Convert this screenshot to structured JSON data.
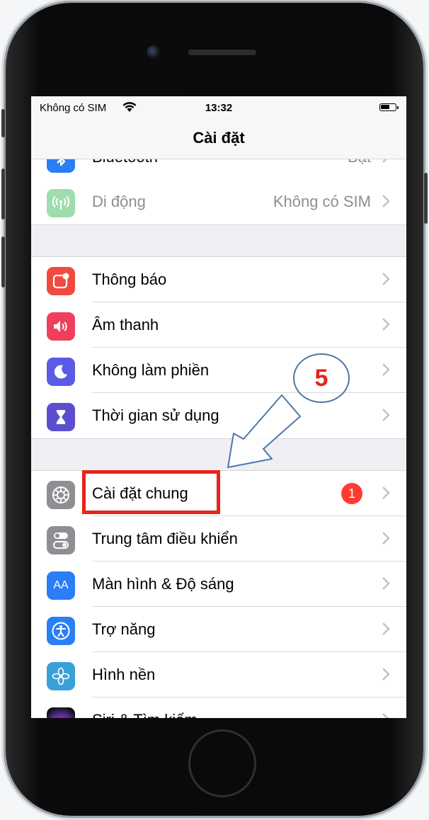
{
  "status_bar": {
    "carrier": "Không có SIM",
    "time": "13:32"
  },
  "nav": {
    "title": "Cài đặt"
  },
  "rows_top": [
    {
      "label": "Bluetooth",
      "value": "Bật",
      "icon": "bluetooth-icon",
      "color": "#2a7ef6"
    },
    {
      "label": "Di động",
      "value": "Không có SIM",
      "icon": "cellular-icon",
      "color": "#9fdcae"
    }
  ],
  "rows_mid": [
    {
      "label": "Thông báo",
      "icon": "notifications-icon",
      "color": "#f04a3e"
    },
    {
      "label": "Âm thanh",
      "icon": "sounds-icon",
      "color": "#ef3f5a"
    },
    {
      "label": "Không làm phiền",
      "icon": "moon-icon",
      "color": "#5b5be6"
    },
    {
      "label": "Thời gian sử dụng",
      "icon": "hourglass-icon",
      "color": "#5b4fcf"
    }
  ],
  "rows_bottom": [
    {
      "label": "Cài đặt chung",
      "badge": "1",
      "icon": "gear-icon",
      "color": "#8e8e93"
    },
    {
      "label": "Trung tâm điều khiển",
      "icon": "toggles-icon",
      "color": "#8e8e93"
    },
    {
      "label": "Màn hình & Độ sáng",
      "icon_text": "AA",
      "icon": "display-icon",
      "color": "#2a7ef6"
    },
    {
      "label": "Trợ năng",
      "icon": "accessibility-icon",
      "color": "#2a7ef6"
    },
    {
      "label": "Hình nền",
      "icon": "wallpaper-icon",
      "color": "#3aa0d8"
    },
    {
      "label": "Siri & Tìm kiếm",
      "icon": "siri-icon",
      "color": "#222222"
    }
  ],
  "annotation": {
    "step": "5"
  }
}
